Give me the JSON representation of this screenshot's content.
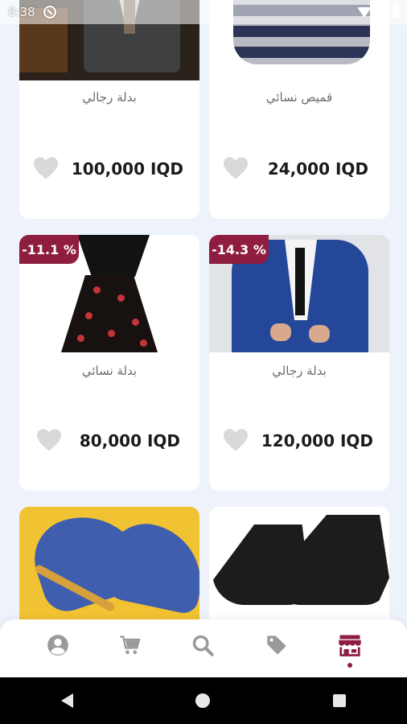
{
  "status": {
    "time": "8:38"
  },
  "products": [
    {
      "name": "بدلة رجالي",
      "price": "100,000 IQD",
      "badge": ""
    },
    {
      "name": "قميص نسائي",
      "price": "24,000 IQD",
      "badge": ""
    },
    {
      "name": "بدلة نسائي",
      "price": "80,000 IQD",
      "badge": "-11.1 %"
    },
    {
      "name": "بدلة رجالي",
      "price": "120,000 IQD",
      "badge": "-14.3 %"
    }
  ],
  "nav": {
    "items": [
      "profile-icon",
      "cart-icon",
      "search-icon",
      "tag-icon",
      "store-icon"
    ],
    "active": "store-icon",
    "accent": "#8e1d3f",
    "inactive": "#9a9a9a"
  },
  "colors": {
    "badge": "#8e1d3f",
    "background": "#eef3fb"
  }
}
